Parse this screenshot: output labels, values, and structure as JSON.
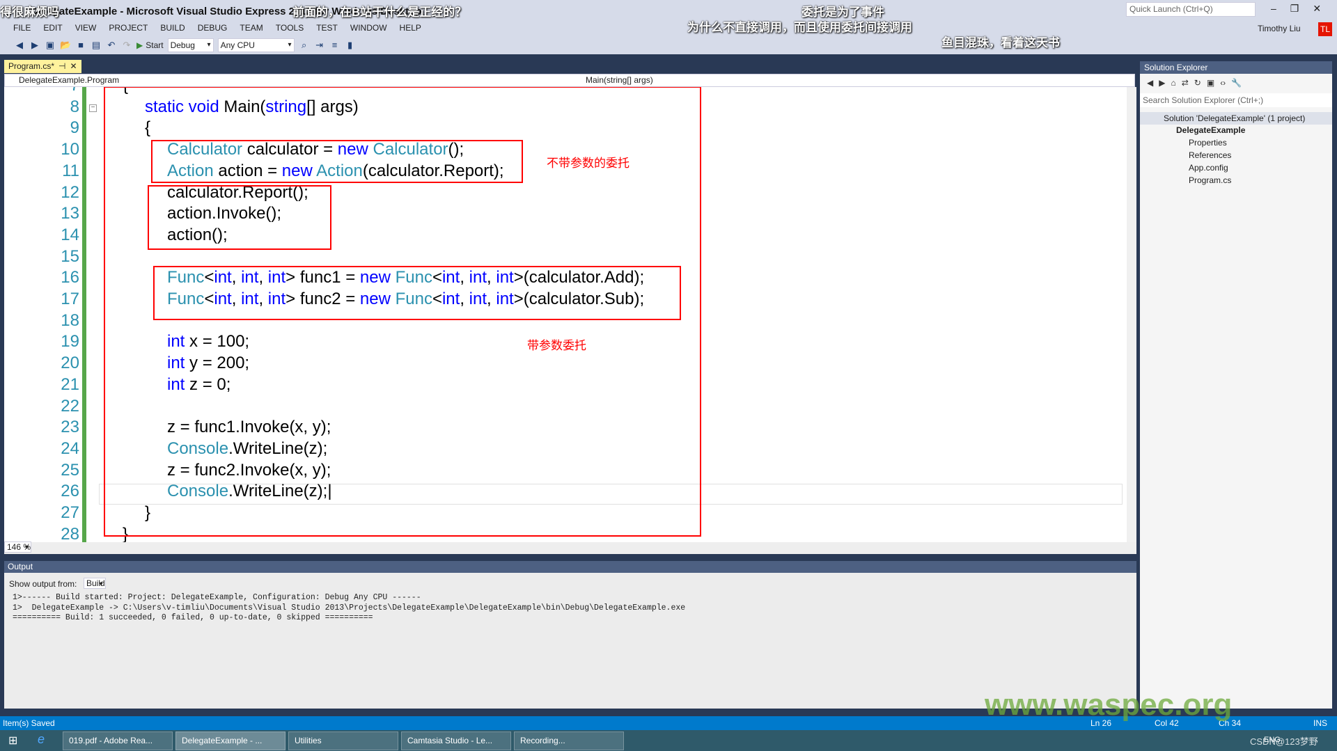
{
  "window": {
    "title": "DelegateExample - Microsoft Visual Studio Express 2013 for Windows Desktop",
    "quick_launch_placeholder": "Quick Launch (Ctrl+Q)",
    "user": "Timothy Liu",
    "user_initials": "TL"
  },
  "subtitles": [
    "得很麻烦吗",
    "前面的，在B站干什么是正经的？",
    "委托是为了事件",
    "为什么不直接调用，而且使用委托间接调用",
    "鱼目混珠，看着这天书"
  ],
  "menu": [
    "FILE",
    "EDIT",
    "VIEW",
    "PROJECT",
    "BUILD",
    "DEBUG",
    "TEAM",
    "TOOLS",
    "TEST",
    "WINDOW",
    "HELP"
  ],
  "toolbar": {
    "start": "Start",
    "config": "Debug",
    "platform": "Any CPU"
  },
  "tab": {
    "label": "Program.cs*"
  },
  "navbar": {
    "class": "DelegateExample.Program",
    "member": "Main(string[] args)"
  },
  "editor": {
    "zoom": "146 %",
    "current_line": 26,
    "lines": [
      {
        "n": 7,
        "i": 0,
        "t": [
          [
            "{",
            "p"
          ]
        ]
      },
      {
        "n": 8,
        "i": 1,
        "t": [
          [
            "static void ",
            "k"
          ],
          [
            "Main(",
            "p"
          ],
          [
            "string",
            "k"
          ],
          [
            "[] args)",
            "p"
          ]
        ]
      },
      {
        "n": 9,
        "i": 1,
        "t": [
          [
            "{",
            "p"
          ]
        ]
      },
      {
        "n": 10,
        "i": 2,
        "t": [
          [
            "Calculator",
            "t"
          ],
          [
            " calculator = ",
            "p"
          ],
          [
            "new ",
            "k"
          ],
          [
            "Calculator",
            "t"
          ],
          [
            "();",
            "p"
          ]
        ]
      },
      {
        "n": 11,
        "i": 2,
        "t": [
          [
            "Action",
            "t"
          ],
          [
            " action = ",
            "p"
          ],
          [
            "new ",
            "k"
          ],
          [
            "Action",
            "t"
          ],
          [
            "(calculator.Report);",
            "p"
          ]
        ]
      },
      {
        "n": 12,
        "i": 2,
        "t": [
          [
            "calculator.Report();",
            "p"
          ]
        ]
      },
      {
        "n": 13,
        "i": 2,
        "t": [
          [
            "action.Invoke();",
            "p"
          ]
        ]
      },
      {
        "n": 14,
        "i": 2,
        "t": [
          [
            "action();",
            "p"
          ]
        ]
      },
      {
        "n": 15,
        "i": 2,
        "t": []
      },
      {
        "n": 16,
        "i": 2,
        "t": [
          [
            "Func",
            "t"
          ],
          [
            "<",
            "p"
          ],
          [
            "int",
            "k"
          ],
          [
            ", ",
            "p"
          ],
          [
            "int",
            "k"
          ],
          [
            ", ",
            "p"
          ],
          [
            "int",
            "k"
          ],
          [
            "> func1 = ",
            "p"
          ],
          [
            "new ",
            "k"
          ],
          [
            "Func",
            "t"
          ],
          [
            "<",
            "p"
          ],
          [
            "int",
            "k"
          ],
          [
            ", ",
            "p"
          ],
          [
            "int",
            "k"
          ],
          [
            ", ",
            "p"
          ],
          [
            "int",
            "k"
          ],
          [
            ">(calculator.Add);",
            "p"
          ]
        ]
      },
      {
        "n": 17,
        "i": 2,
        "t": [
          [
            "Func",
            "t"
          ],
          [
            "<",
            "p"
          ],
          [
            "int",
            "k"
          ],
          [
            ", ",
            "p"
          ],
          [
            "int",
            "k"
          ],
          [
            ", ",
            "p"
          ],
          [
            "int",
            "k"
          ],
          [
            "> func2 = ",
            "p"
          ],
          [
            "new ",
            "k"
          ],
          [
            "Func",
            "t"
          ],
          [
            "<",
            "p"
          ],
          [
            "int",
            "k"
          ],
          [
            ", ",
            "p"
          ],
          [
            "int",
            "k"
          ],
          [
            ", ",
            "p"
          ],
          [
            "int",
            "k"
          ],
          [
            ">(calculator.Sub);",
            "p"
          ]
        ]
      },
      {
        "n": 18,
        "i": 2,
        "t": []
      },
      {
        "n": 19,
        "i": 2,
        "t": [
          [
            "int",
            "k"
          ],
          [
            " x = 100;",
            "p"
          ]
        ]
      },
      {
        "n": 20,
        "i": 2,
        "t": [
          [
            "int",
            "k"
          ],
          [
            " y = 200;",
            "p"
          ]
        ]
      },
      {
        "n": 21,
        "i": 2,
        "t": [
          [
            "int",
            "k"
          ],
          [
            " z = 0;",
            "p"
          ]
        ]
      },
      {
        "n": 22,
        "i": 2,
        "t": []
      },
      {
        "n": 23,
        "i": 2,
        "t": [
          [
            "z = func1.Invoke(x, y);",
            "p"
          ]
        ]
      },
      {
        "n": 24,
        "i": 2,
        "t": [
          [
            "Console",
            "t"
          ],
          [
            ".WriteLine(z);",
            "p"
          ]
        ]
      },
      {
        "n": 25,
        "i": 2,
        "t": [
          [
            "z = func2.Invoke(x, y);",
            "p"
          ]
        ]
      },
      {
        "n": 26,
        "i": 2,
        "t": [
          [
            "Console",
            "t"
          ],
          [
            ".WriteLine(z);",
            "p"
          ]
        ]
      },
      {
        "n": 27,
        "i": 1,
        "t": [
          [
            "}",
            "p"
          ]
        ]
      },
      {
        "n": 28,
        "i": 0,
        "t": [
          [
            "}",
            "p"
          ]
        ]
      }
    ],
    "annotations": [
      "不带参数的委托",
      "带参数委托"
    ],
    "annotation_color": "#ff0000"
  },
  "output": {
    "title": "Output",
    "show_from_label": "Show output from:",
    "source": "Build",
    "lines": [
      "1>------ Build started: Project: DelegateExample, Configuration: Debug Any CPU ------",
      "1>  DelegateExample -> C:\\Users\\v-timliu\\Documents\\Visual Studio 2013\\Projects\\DelegateExample\\DelegateExample\\bin\\Debug\\DelegateExample.exe",
      "========== Build: 1 succeeded, 0 failed, 0 up-to-date, 0 skipped =========="
    ]
  },
  "solution_explorer": {
    "title": "Solution Explorer",
    "search_placeholder": "Search Solution Explorer (Ctrl+;)",
    "solution": "Solution 'DelegateExample' (1 project)",
    "project": "DelegateExample",
    "items": [
      "Properties",
      "References",
      "App.config",
      "Program.cs"
    ]
  },
  "status": {
    "message": "Item(s) Saved",
    "ln": "Ln 26",
    "col": "Col 42",
    "ch": "Ch 34",
    "mode": "INS"
  },
  "taskbar": {
    "items": [
      "019.pdf - Adobe Rea...",
      "DelegateExample - ...",
      "Utilities",
      "Camtasia Studio - Le...",
      "Recording..."
    ],
    "tray": "ENG",
    "watermark_csdn": "CSDN@123梦野"
  },
  "watermark": "www.waspec.org"
}
